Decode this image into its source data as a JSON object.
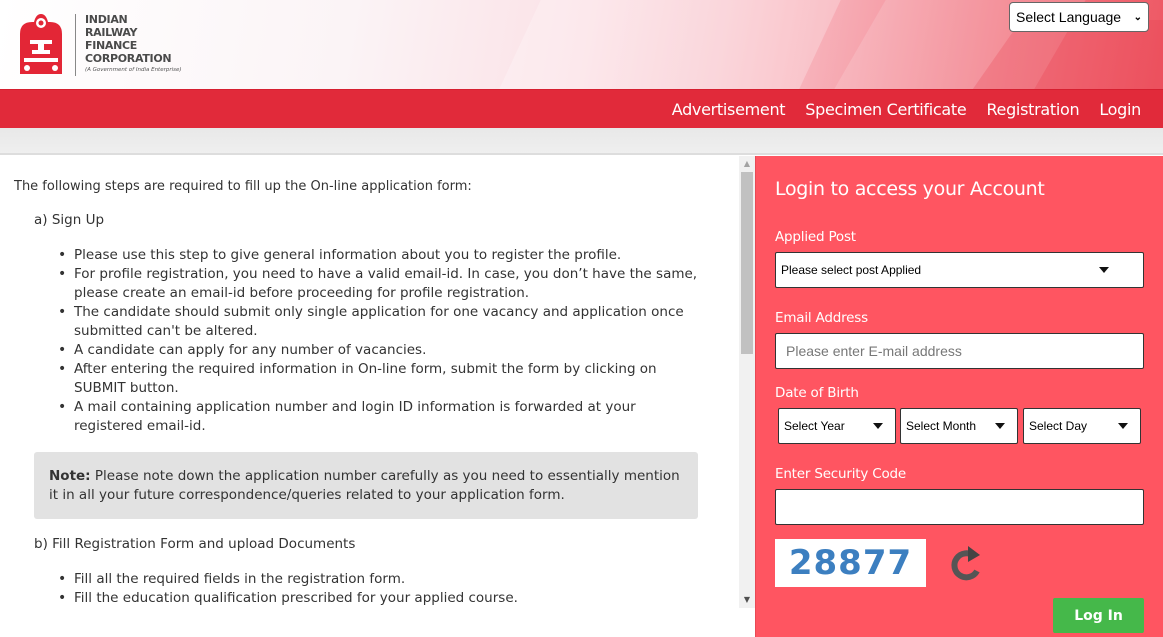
{
  "header": {
    "logo": {
      "line1": "INDIAN",
      "line2": "RAILWAY",
      "line3": "FINANCE",
      "line4": "CORPORATION",
      "subtitle": "(A Government of India Enterprise)"
    },
    "language_select": {
      "selected": "Select Language"
    }
  },
  "nav": {
    "items": [
      {
        "label": "Advertisement"
      },
      {
        "label": "Specimen Certificate"
      },
      {
        "label": "Registration"
      },
      {
        "label": "Login"
      }
    ]
  },
  "content": {
    "intro": "The following steps are required to fill up the On-line application form:",
    "section_a": {
      "heading": "a) Sign Up",
      "bullets": [
        "Please use this step to give general information about you to register the profile.",
        "For profile registration, you need to have a valid email-id. In case, you don’t have the same, please create an email-id before proceeding for profile registration.",
        "The candidate should submit only single application for one vacancy and application once submitted can't be altered.",
        "A candidate can apply for any number of vacancies.",
        "After entering the required information in On-line form, submit the form by clicking on SUBMIT button.",
        "A mail containing application number and login ID information is forwarded at your registered email-id."
      ]
    },
    "note": {
      "label": "Note:",
      "text": " Please note down the application number carefully as you need to essentially mention it in all your future correspondence/queries related to your application form."
    },
    "section_b": {
      "heading": "b) Fill Registration Form and upload Documents",
      "bullets": [
        "Fill all the required fields in the registration form.",
        "Fill the education qualification prescribed for your applied course."
      ]
    }
  },
  "login": {
    "title": "Login to access your Account",
    "applied_post": {
      "label": "Applied Post",
      "selected": "Please select post Applied"
    },
    "email": {
      "label": "Email Address",
      "placeholder": "Please enter E-mail address",
      "value": ""
    },
    "dob": {
      "label": "Date of Birth",
      "year": "Select Year",
      "month": "Select Month",
      "day": "Select Day"
    },
    "security": {
      "label": "Enter Security Code",
      "value": "",
      "captcha": "28877"
    },
    "submit_label": "Log In"
  },
  "colors": {
    "nav_red": "#e12a3a",
    "panel_red": "#ff5561",
    "login_green": "#45b84a",
    "captcha_blue": "#3c7fc0"
  }
}
